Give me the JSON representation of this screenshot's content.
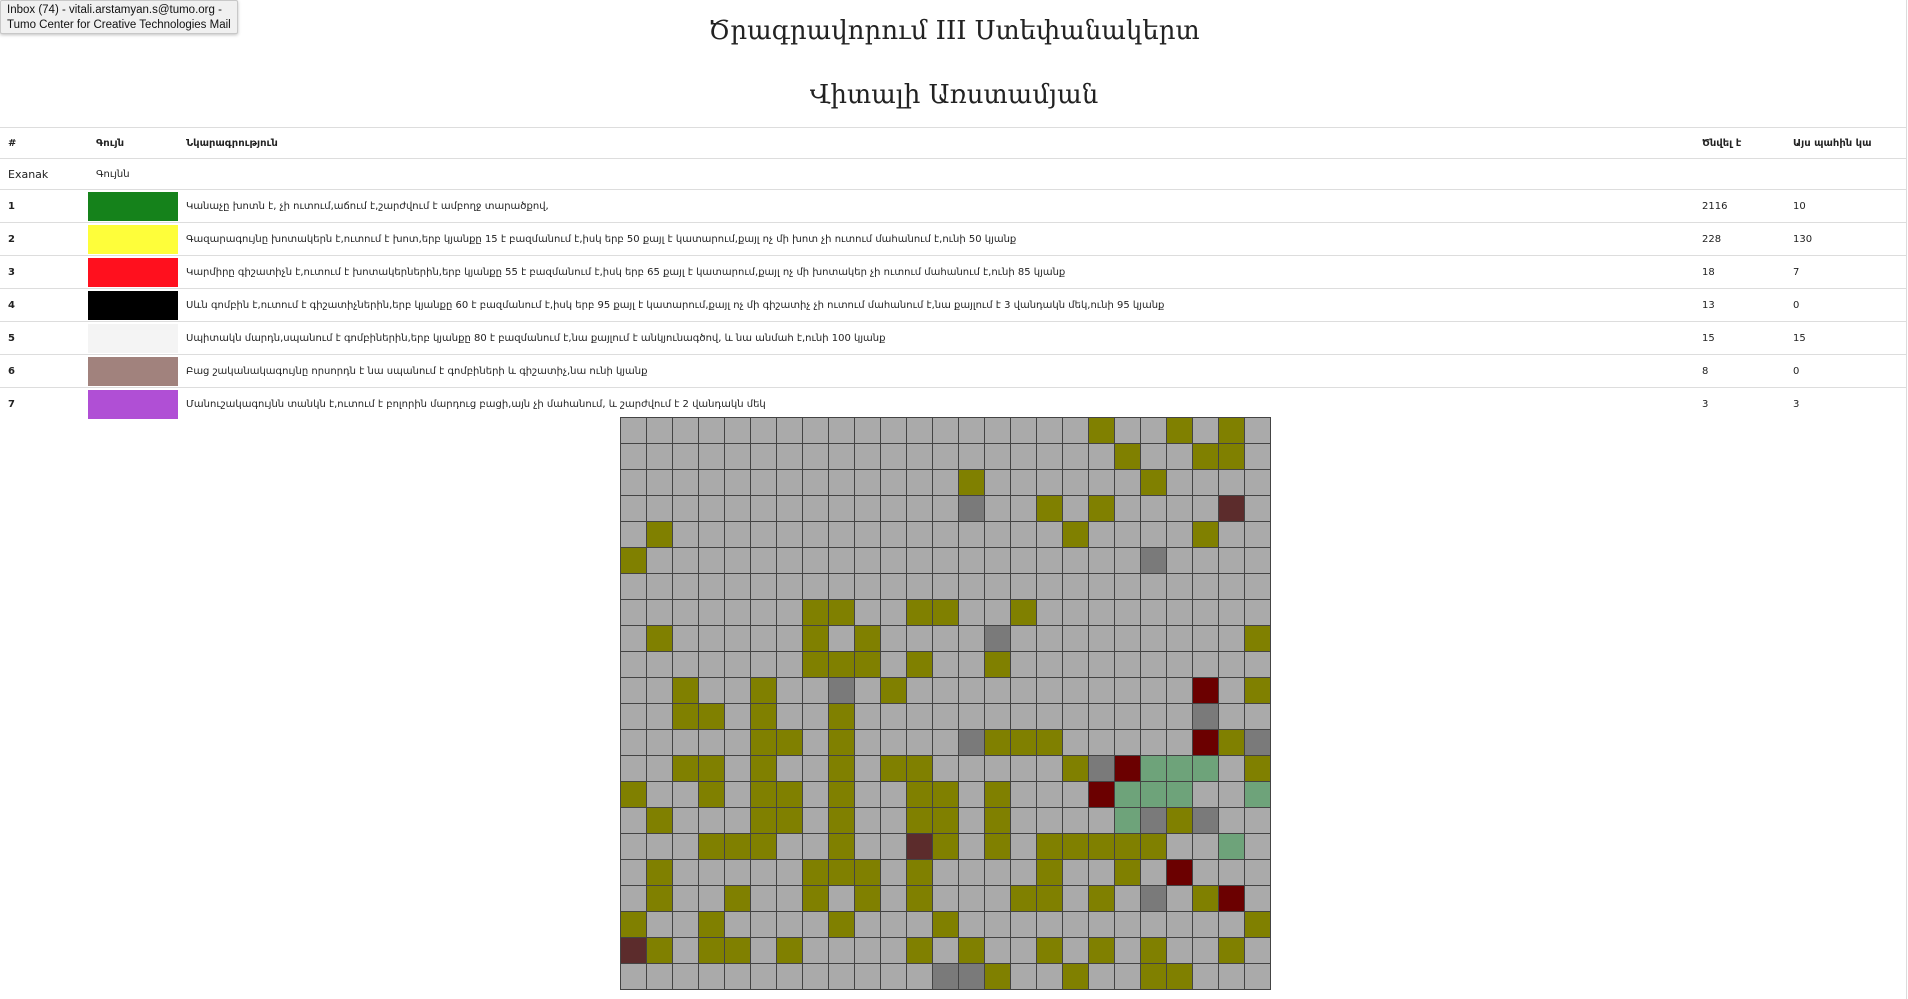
{
  "tooltip": {
    "line1": "Inbox (74) - vitali.arstamyan.s@tumo.org -",
    "line2": "Tumo Center for Creative Technologies Mail"
  },
  "page": {
    "title": "Ծրագրավորում III Ստեփանակերտ",
    "subtitle": "Վիտալի Առստամյան"
  },
  "table": {
    "headers": [
      "#",
      "Գույն",
      "Նկարագրություն",
      "Ծնվել է",
      "Այս պահին կա"
    ],
    "example_label": "Exanak",
    "example_color": "Գույնն",
    "rows": [
      {
        "num": "1",
        "color": "#15821b",
        "desc": "Կանաչը խոտն է, չի ուտում,աճում է,շարժվում է ամբողջ տարածքով,",
        "born": "2116",
        "now": "10"
      },
      {
        "num": "2",
        "color": "#fefe3a",
        "desc": "Գազարագույնը խոտակերն է,ուտում է խոտ,երբ կյանքը 15 է բազմանում է,իսկ երբ 50 քայլ է կատարում,քայլ ոչ մի խոտ չի ուտում մահանում է,ունի 50 կյանք",
        "born": "228",
        "now": "130"
      },
      {
        "num": "3",
        "color": "#ff101e",
        "desc": "Կարմիրը գիշատիչն է,ուտում է խոտակերներին,երբ կյանքը 55 է բազմանում է,իսկ երբ 65 քայլ է կատարում,քայլ ոչ մի խոտակեր չի ուտում մահանում է,ունի 85 կյանք",
        "born": "18",
        "now": "7"
      },
      {
        "num": "4",
        "color": "#000000",
        "desc": "Սևն գոմբին է,ուտում է գիշատիչներին,երբ կյանքը 60 է բազմանում է,իսկ երբ 95 քայլ է կատարում,քայլ ոչ մի գիշատիչ չի ուտում մահանում է,նա քայլում է 3 վանդակն մեկ,ունի 95 կյանք",
        "born": "13",
        "now": "0"
      },
      {
        "num": "5",
        "color": "#f4f4f4",
        "desc": "Սպիտակն մարդն,սպանում է գոմբիներին,երբ կյանքը 80 է բազմանում է,նա քայլում է անկյունագծով, և նա անմահ է,ունի 100 կյանք",
        "born": "15",
        "now": "15"
      },
      {
        "num": "6",
        "color": "#a1827d",
        "desc": "Բաց շականակագույնը որսորդն է նա սպանում է գոմբիների և գիշատիչ,նա ունի կյանք",
        "born": "8",
        "now": "0"
      },
      {
        "num": "7",
        "color": "#b04fd5",
        "desc": "Մանուշակագույնն տանկն է,ուտում է բոլորին մարդուց բացի,այն չի մահանում, և շարժվում է 2 վանդակն մեկ",
        "born": "3",
        "now": "3"
      }
    ]
  },
  "grid": {
    "columns": 25,
    "legend": {
      "0": "#aaaaaa",
      "1": "#808000",
      "2": "#7a7a7a",
      "3": "#5c2c2c",
      "4": "#6b0000",
      "5": "#6ea37a"
    },
    "rows": [
      "0000000000000000001001010",
      "0000000000000000000100110",
      "0000000000000100000010000",
      "0000000000000200101000030",
      "0100000000000000010000100",
      "1000000000000000000020000",
      "0000000000000000000000000",
      "0000000110011001000000000",
      "0100000101000020000000001",
      "0000000111010010000000000",
      "0010010020100000000000401",
      "0011010010000000000000200",
      "0000011010000211100000412",
      "0011010010110000012455501",
      "1001011010011010004555005",
      "0100011010011010000521200",
      "0001110010031010111110050",
      "0100000111010000100104000",
      "0100100101010001101020140",
      "1001000010001000000000001",
      "3101101000010100101010010",
      "0000000000002210010011000"
    ]
  }
}
